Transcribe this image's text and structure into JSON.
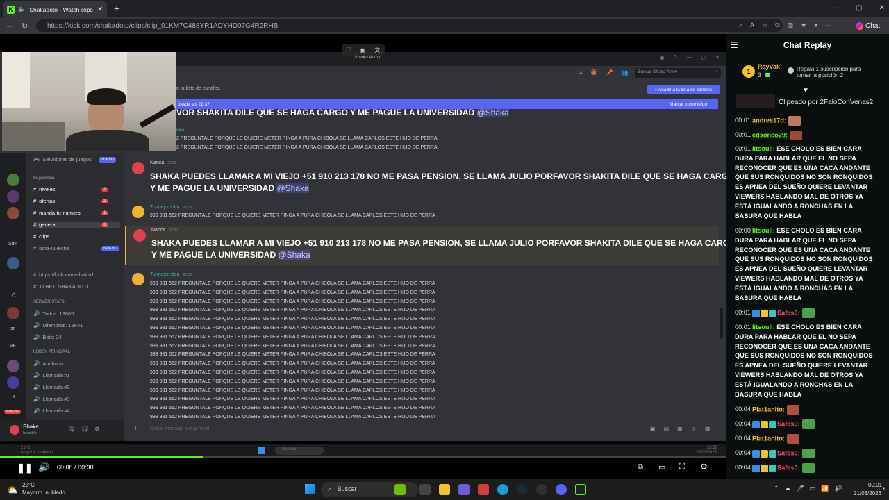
{
  "browser": {
    "tab_title": "Shakadoto - Watch clips on K",
    "url": "https://kick.com/shakadoto/clips/clip_01KM7C488YR1ADYHD07G4R2RHB",
    "chat_button": "Chat",
    "new_tab": "+",
    "tab_close": "✕"
  },
  "video": {
    "discord": {
      "server_name": "Shaka Army",
      "search_placeholder": "Buscar Shaka Army",
      "channel_list_notice": "n tu lista de canales.",
      "add_to_list": "+ Añadir a la lista de canales",
      "new_messages_since": "desde las 22:37",
      "mark_as_read": "Marcar como leído",
      "top_banner": "VOR SHAKITA DILE QUE SE HAGA CARGO Y ME PAGUE LA UNIVERSIDAD",
      "top_banner_mention": "@Shaka",
      "top_name": "idea",
      "top_lines": [
        "2 PREGUNTALE PORQUE LE QUIERE METER PINGA A PURA CHIBOLA SE LLAMA CARLOS ESTE HIJO DE PERRA",
        "2 PREGUNTALE PORQUE LE QUIERE METER PINGA A PURA CHIBOLA SE LLAMA CARLOS ESTE HIJO DE PERRA"
      ],
      "servers_de_juegos": "Servidores de juegos",
      "nuevo": "NUEVO",
      "sugerencia": "Sugerencia",
      "channels": [
        {
          "name": "niveles",
          "badge": "2"
        },
        {
          "name": "ofertas",
          "badge": "2"
        },
        {
          "name": "manda-tu-numero",
          "badge": "1"
        },
        {
          "name": "general",
          "badge": "3"
        },
        {
          "name": "clips",
          "badge": ""
        },
        {
          "name": "bota-tu-leche",
          "badge": "NUEVO"
        }
      ],
      "links": [
        "https://kick.com/shakad...",
        "1XBET: SHAKADOTO"
      ],
      "server_stats": "SERVER STATS",
      "stats": [
        "Todos: 18865",
        "Miembros: 18841",
        "Bots: 24"
      ],
      "lobby": "LOBBY PRINCIPAL",
      "voice": [
        "Auditoria",
        "Llamada #1",
        "Llamada #2",
        "Llamada #3",
        "Llamada #4"
      ],
      "guild_labels": [
        "SdK",
        "C",
        "sr",
        "VF",
        "x",
        "NUEVO"
      ],
      "user_name": "Shaka",
      "user_status": "Invisible",
      "messages": [
        {
          "author": "Nanca",
          "time": "22:36",
          "text": "SHAKA PUEDES LLAMAR A MI VIEJO +51 910 213 178 NO ME PASA PENSION, SE LLAMA JULIO PORFAVOR SHAKITA DILE QUE SE HAGA CARGO",
          "text2": "Y ME PAGUE LA UNIVERSIDAD",
          "mention": "@Shaka"
        },
        {
          "author": "Tu mejor idea",
          "time": "22:36",
          "text": "999 981 552 PREGUNTALE PORQUE LE QUIERE METER PINGA A PURA CHIBOLA SE LLAMA CARLOS ESTE HIJO DE PERRA"
        },
        {
          "author": "Nanca",
          "time": "22:36",
          "text": "SHAKA PUEDES LLAMAR A MI VIEJO +51 910 213 178 NO ME PASA PENSION, SE LLAMA JULIO PORFAVOR SHAKITA DILE QUE SE HAGA CARGO",
          "text2": "Y ME PAGUE LA UNIVERSIDAD",
          "mention": "@Shaka"
        },
        {
          "author": "Tu mejor idea",
          "time": "22:36"
        }
      ],
      "spam_line": "999 981 552 PREGUNTALE PORQUE LE QUIERE METER PINGA A PURA CHIBOLA SE LLAMA CARLOS ESTE HIJO DE PERRA",
      "input_placeholder": "Enviar mensaje a # general"
    },
    "inner_taskbar": {
      "weather_temp": "21°C",
      "weather_desc": "Mayorm. nublado",
      "search": "Buscar",
      "time": "22:38",
      "date": "20/03/2026"
    },
    "progress": 0.28,
    "time_current": "00:08",
    "time_total": "00:30",
    "time_sep": "/"
  },
  "chat": {
    "title": "Chat Replay",
    "gifter_name": "RayVak",
    "gifter_rank": "1",
    "gifter_count": "3",
    "gift_text": "Regala 1 suscripción para tomar la posición 2",
    "clip_by": "Clipeado por 2FaloConVenas2",
    "messages": [
      {
        "time": "00:01",
        "user": "andres17d",
        "color": "#f2c230",
        "text": "",
        "emote": "#c07a5a"
      },
      {
        "time": "00:01",
        "user": "edsonco29",
        "color": "#53fc18",
        "text": "",
        "emote": "#9b4a3a"
      },
      {
        "time": "00:01",
        "user": "litsoull",
        "color": "#53fc18",
        "text": "ESE CHOLO ES BIEN CARA DURA PARA HABLAR QUE EL NO SEPA RECONOCER QUE ES UNA CACA ANDANTE QUE SUS RONQUIDOS NO SON RONQUIDOS ES APNEA DEL SUEÑO QUIERE LEVANTAR VIEWERS HABLANDO MAL DE OTROS YA ESTÁ IGUALANDO A RONCHAS EN LA BASURA QUE HABLA"
      },
      {
        "time": "00:00",
        "user": "litsoull",
        "color": "#53fc18",
        "text": "ESE CHOLO ES BIEN CARA DURA PARA HABLAR QUE EL NO SEPA RECONOCER QUE ES UNA CACA ANDANTE QUE SUS RONQUIDOS NO SON RONQUIDOS ES APNEA DEL SUEÑO QUIERE LEVANTAR VIEWERS HABLANDO MAL DE OTROS YA ESTÁ IGUALANDO A RONCHAS EN LA BASURA QUE HABLA"
      },
      {
        "time": "00:01",
        "user": "Safes0",
        "color": "#ff4d5a",
        "text": "",
        "emote": "#4aa34a",
        "badges": true
      },
      {
        "time": "00:01",
        "user": "litsoull",
        "color": "#53fc18",
        "text": "ESE CHOLO ES BIEN CARA DURA PARA HABLAR QUE EL NO SEPA RECONOCER QUE ES UNA CACA ANDANTE QUE SUS RONQUIDOS NO SON RONQUIDOS ES APNEA DEL SUEÑO QUIERE LEVANTAR VIEWERS HABLANDO MAL DE OTROS YA ESTÁ IGUALANDO A RONCHAS EN LA BASURA QUE HABLA"
      },
      {
        "time": "00:04",
        "user": "Plat1anito",
        "color": "#f2c230",
        "text": "",
        "emote": "#b0503a"
      },
      {
        "time": "00:04",
        "user": "Safes0",
        "color": "#ff4d5a",
        "text": "",
        "emote": "#4aa34a",
        "badges": true
      },
      {
        "time": "00:04",
        "user": "Plat1anito",
        "color": "#f2c230",
        "text": "",
        "emote": "#b0503a"
      },
      {
        "time": "00:04",
        "user": "Safes0",
        "color": "#ff4d5a",
        "text": "",
        "emote": "#4aa34a",
        "badges": true
      },
      {
        "time": "00:04",
        "user": "Safes0",
        "color": "#ff4d5a",
        "text": "",
        "emote": "#4aa34a",
        "badges": true
      }
    ]
  },
  "taskbar": {
    "weather_temp": "22°C",
    "weather_desc": "Mayorm. nublado",
    "search": "Buscar",
    "time": "00:01",
    "date": "21/03/2026"
  },
  "colors": {
    "kick_green": "#53fc18",
    "discord_blurple": "#5865f2",
    "mention_red": "#f23f43"
  }
}
